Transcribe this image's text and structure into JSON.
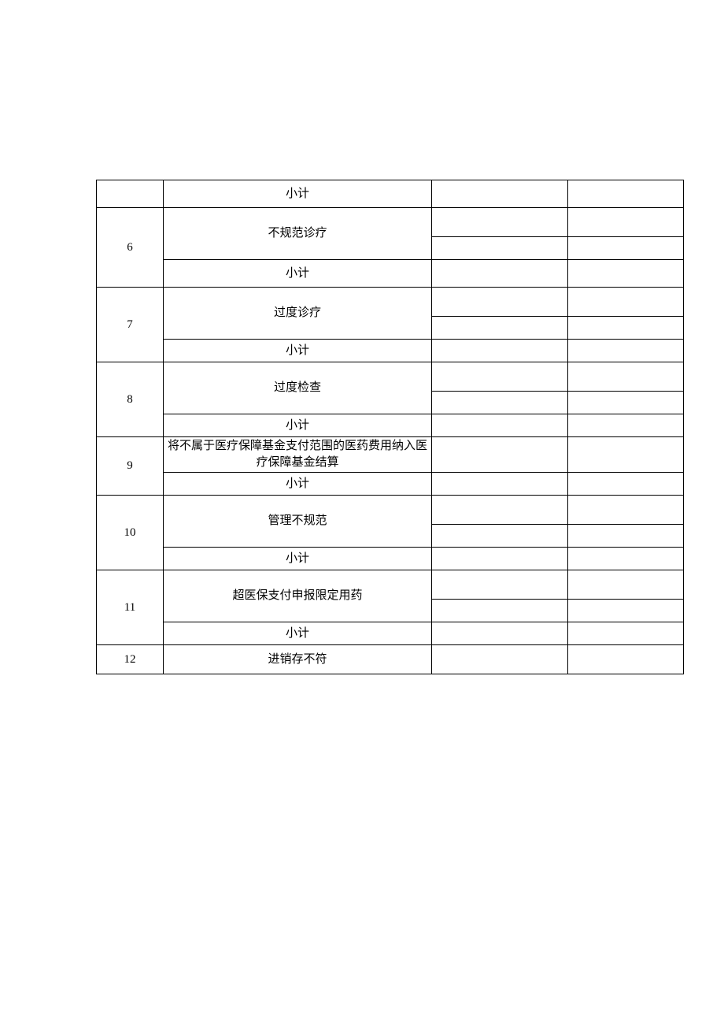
{
  "labels": {
    "subtotal": "小计"
  },
  "rows": [
    {
      "num": "6",
      "desc": "不规范诊疗"
    },
    {
      "num": "7",
      "desc": "过度诊疗"
    },
    {
      "num": "8",
      "desc": "过度检查"
    },
    {
      "num": "9",
      "desc": "将不属于医疗保障基金支付范围的医药费用纳入医疗保障基金结算"
    },
    {
      "num": "10",
      "desc": "管理不规范"
    },
    {
      "num": "11",
      "desc": "超医保支付申报限定用药"
    },
    {
      "num": "12",
      "desc": "进销存不符"
    }
  ]
}
